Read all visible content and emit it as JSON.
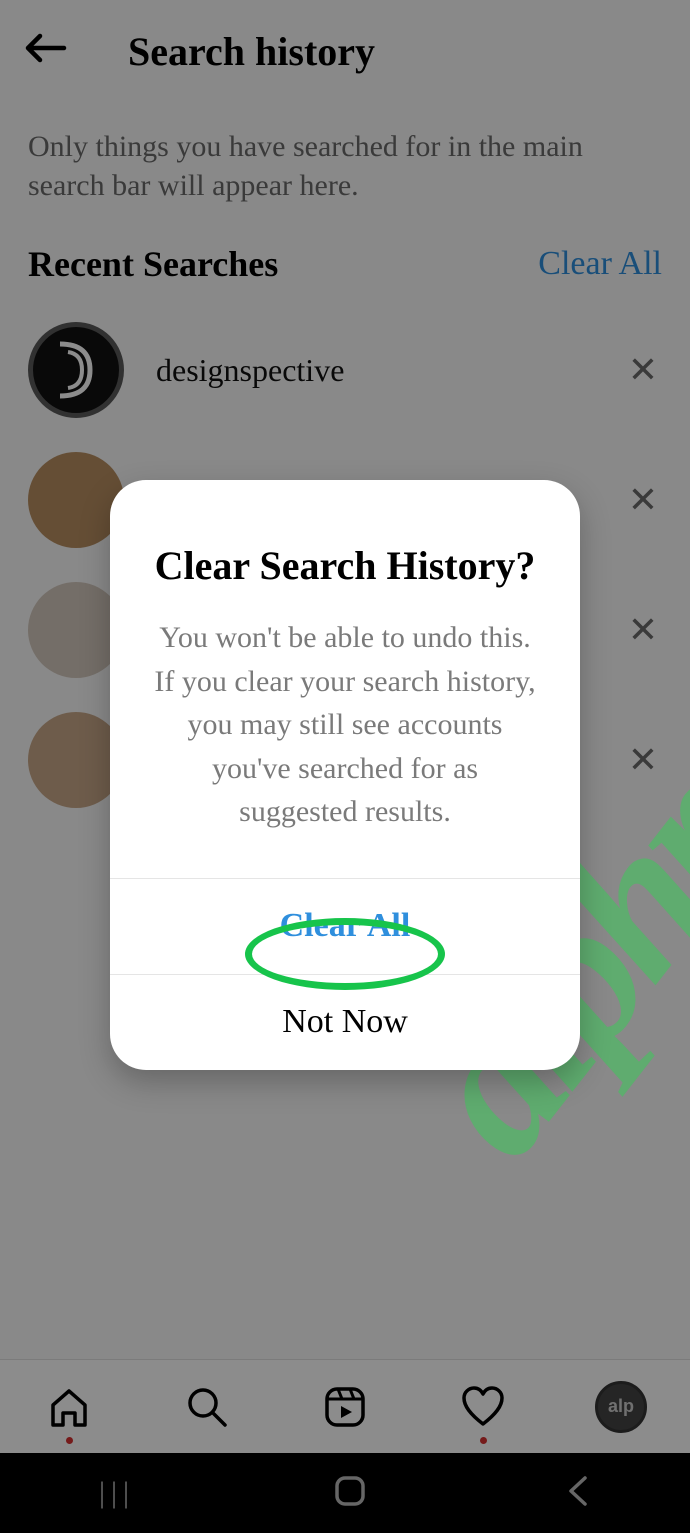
{
  "header": {
    "title": "Search history"
  },
  "subtitle": "Only things you have searched for in the main search bar will appear here.",
  "section": {
    "title": "Recent Searches",
    "clear_link": "Clear All"
  },
  "searches": [
    {
      "username": "designspective"
    },
    {
      "username": ""
    },
    {
      "username": ""
    },
    {
      "username": ""
    }
  ],
  "dialog": {
    "title": "Clear Search History?",
    "body": "You won't be able to undo this. If you clear your search history, you may still see accounts you've searched for as suggested results.",
    "primary": "Clear All",
    "secondary": "Not Now"
  },
  "watermark": "alphr.com"
}
